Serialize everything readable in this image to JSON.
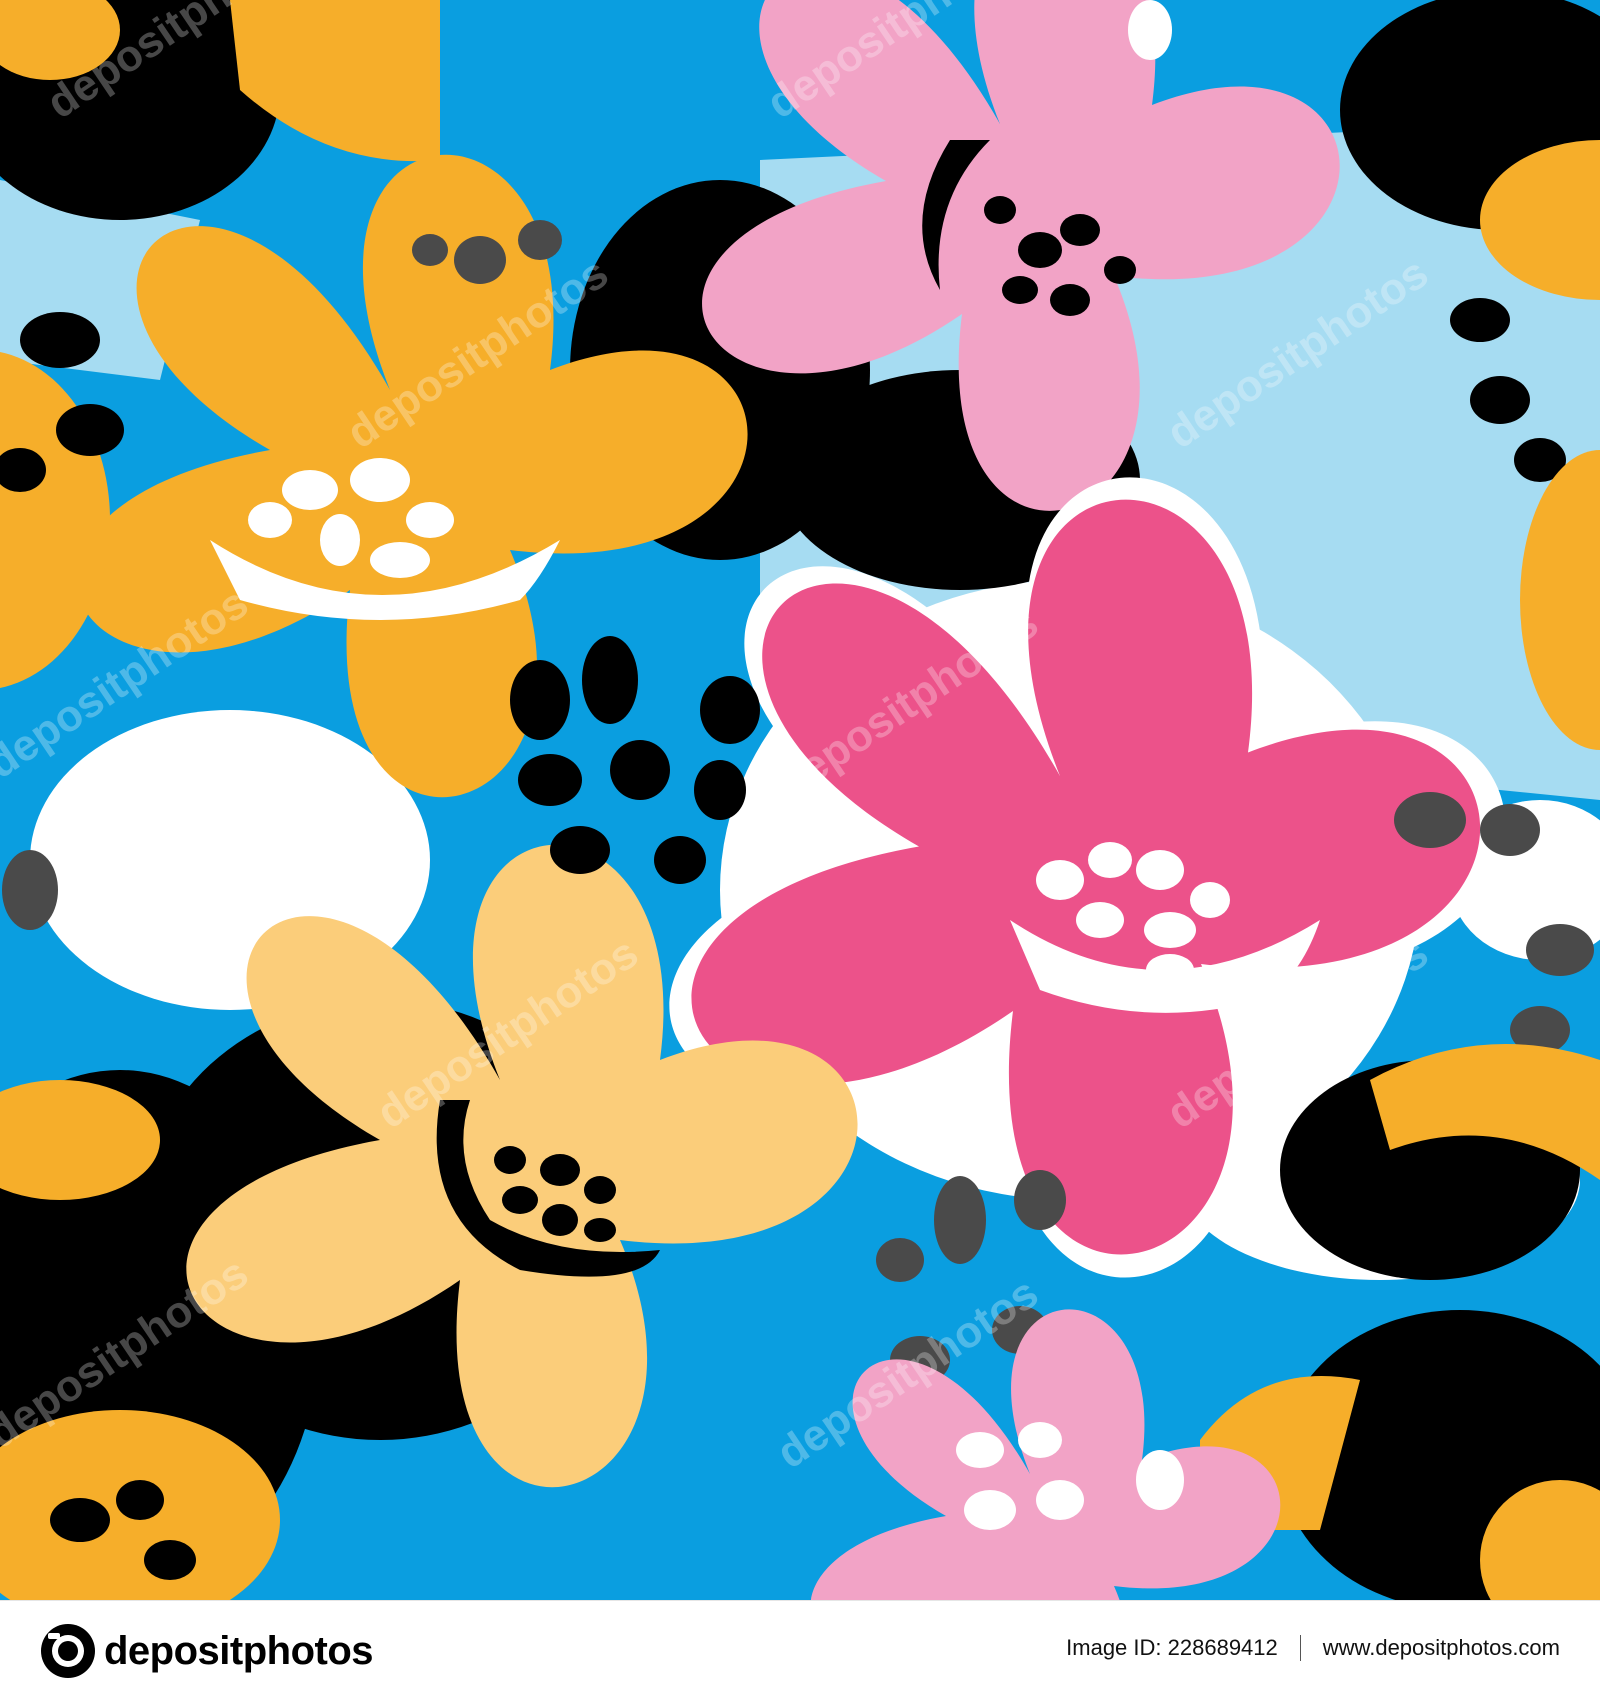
{
  "artwork": {
    "watermark_text": "depositphotos",
    "colors": {
      "background_dark_blue": "#0a9ee0",
      "background_light_blue": "#a6dcf2",
      "orange": "#f6ae2a",
      "light_orange": "#fbcd7a",
      "pink": "#f2a3c6",
      "hot_pink": "#ec528a",
      "black": "#000000",
      "gray": "#4a4a4a",
      "white": "#ffffff"
    }
  },
  "footer": {
    "brand_name": "depositphotos",
    "image_id_label": "Image ID:",
    "image_id": "228689412",
    "website": "www.depositphotos.com"
  }
}
